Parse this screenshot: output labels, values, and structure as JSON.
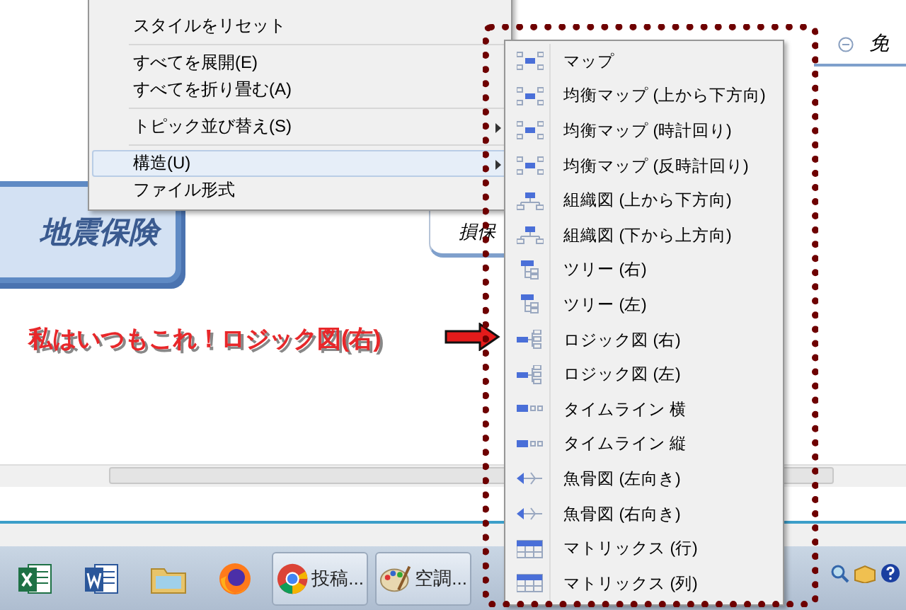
{
  "canvas": {
    "central_topic": "地震保険",
    "topic": "損保",
    "partial_topic": "免",
    "annotation": "私はいつもこれ！ロジック図(右)"
  },
  "context_menu": {
    "items": [
      {
        "label": "スタイルをリセット",
        "separator_before": false,
        "submenu": false,
        "selected": false
      },
      {
        "label": "すべてを展開(E)",
        "separator_before": true,
        "submenu": false,
        "selected": false
      },
      {
        "label": "すべてを折り畳む(A)",
        "separator_before": false,
        "submenu": false,
        "selected": false
      },
      {
        "label": "トピック並び替え(S)",
        "separator_before": true,
        "submenu": true,
        "selected": false
      },
      {
        "label": "構造(U)",
        "separator_before": true,
        "submenu": true,
        "selected": true
      },
      {
        "label": "ファイル形式",
        "separator_before": false,
        "submenu": false,
        "selected": false
      }
    ]
  },
  "structure_submenu": {
    "items": [
      {
        "label": "マップ",
        "kind": "map"
      },
      {
        "label": "均衡マップ (上から下方向)",
        "kind": "map"
      },
      {
        "label": "均衡マップ (時計回り)",
        "kind": "map"
      },
      {
        "label": "均衡マップ (反時計回り)",
        "kind": "map"
      },
      {
        "label": "組織図 (上から下方向)",
        "kind": "org"
      },
      {
        "label": "組織図 (下から上方向)",
        "kind": "org"
      },
      {
        "label": "ツリー (右)",
        "kind": "tree"
      },
      {
        "label": "ツリー (左)",
        "kind": "tree"
      },
      {
        "label": "ロジック図 (右)",
        "kind": "logic"
      },
      {
        "label": "ロジック図 (左)",
        "kind": "logic"
      },
      {
        "label": "タイムライン 横",
        "kind": "timeline"
      },
      {
        "label": "タイムライン 縦",
        "kind": "timeline"
      },
      {
        "label": "魚骨図 (左向き)",
        "kind": "fishbone"
      },
      {
        "label": "魚骨図 (右向き)",
        "kind": "fishbone"
      },
      {
        "label": "マトリックス (行)",
        "kind": "matrix"
      },
      {
        "label": "マトリックス (列)",
        "kind": "matrix"
      }
    ]
  },
  "taskbar": {
    "buttons": [
      {
        "kind": "excel"
      },
      {
        "kind": "word"
      },
      {
        "kind": "folder"
      },
      {
        "kind": "firefox"
      },
      {
        "kind": "chrome",
        "label": "投稿..."
      },
      {
        "kind": "paint",
        "label": "空調..."
      }
    ]
  }
}
